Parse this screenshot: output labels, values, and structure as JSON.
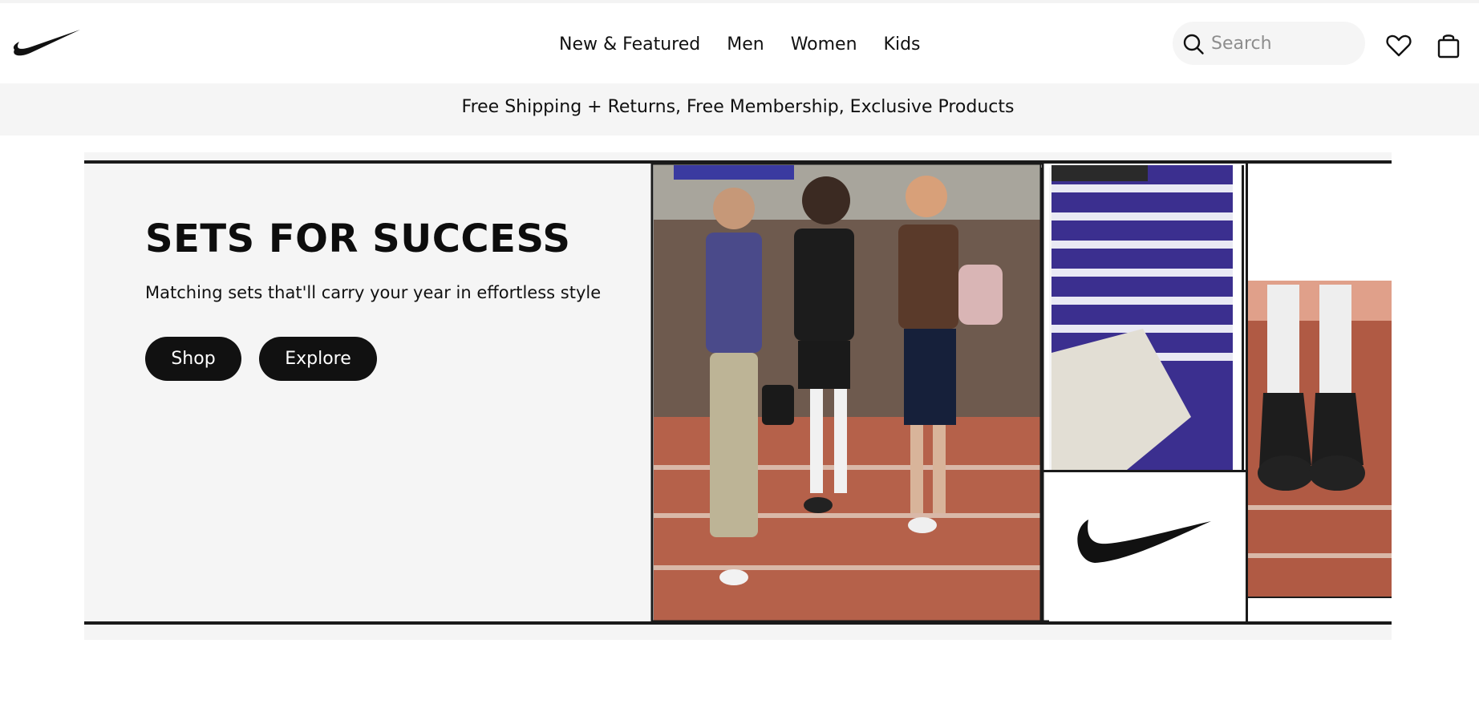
{
  "brand": {
    "logo_icon": "swoosh-logo-icon"
  },
  "nav": {
    "items": [
      {
        "label": "New & Featured"
      },
      {
        "label": "Men"
      },
      {
        "label": "Women"
      },
      {
        "label": "Kids"
      }
    ]
  },
  "search": {
    "placeholder": "Search",
    "value": "",
    "icon": "search-icon"
  },
  "header_icons": {
    "favorites": "heart-icon",
    "bag": "shopping-bag-icon"
  },
  "promo": {
    "text": "Free Shipping + Returns, Free Membership, Exclusive Products"
  },
  "hero": {
    "title": "SETS FOR SUCCESS",
    "subtitle": "Matching sets that'll carry your year in effortless style",
    "shop_label": "Shop",
    "explore_label": "Explore"
  },
  "colors": {
    "accent": "#111111",
    "surface": "#f5f5f5",
    "background": "#ffffff"
  }
}
